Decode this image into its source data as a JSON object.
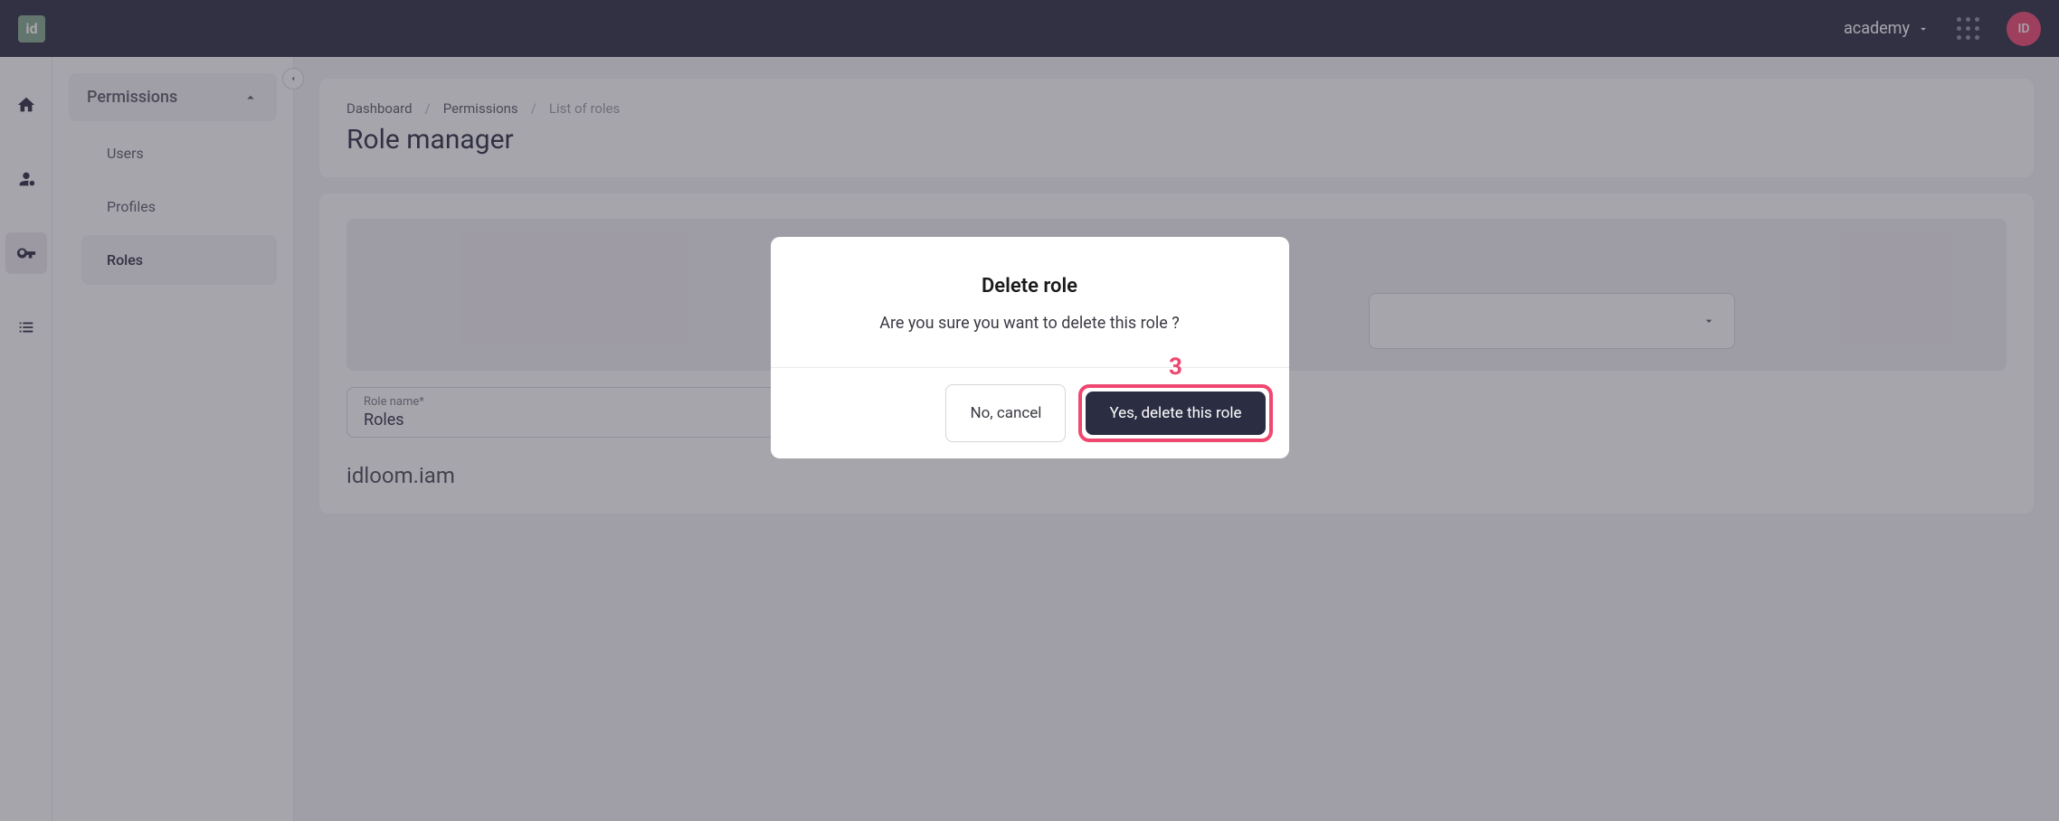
{
  "header": {
    "logo_text": "id",
    "account_label": "academy",
    "avatar_initials": "ID"
  },
  "icon_sidebar": {
    "items": [
      "home",
      "users",
      "key",
      "list"
    ]
  },
  "nav_sidebar": {
    "section_title": "Permissions",
    "items": [
      {
        "label": "Users"
      },
      {
        "label": "Profiles"
      },
      {
        "label": "Roles"
      }
    ]
  },
  "breadcrumb": {
    "items": [
      {
        "label": "Dashboard"
      },
      {
        "label": "Permissions"
      },
      {
        "label": "List of roles"
      }
    ]
  },
  "page_title": "Role manager",
  "form": {
    "role_name_label": "Role name*",
    "role_name_value": "Roles",
    "section_heading": "idloom.iam"
  },
  "modal": {
    "title": "Delete role",
    "text": "Are you sure you want to delete this role ?",
    "cancel_label": "No, cancel",
    "confirm_label": "Yes, delete this role",
    "annotation": "3"
  }
}
